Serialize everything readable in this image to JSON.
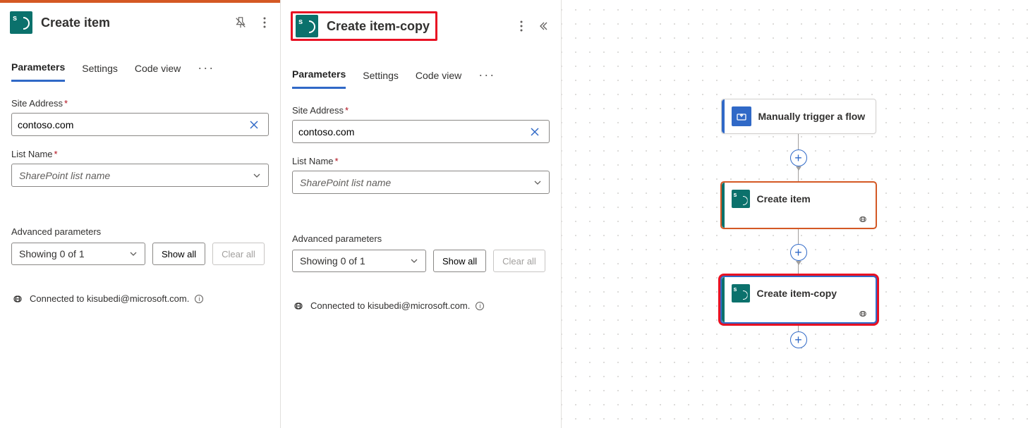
{
  "panel_left": {
    "title": "Create item",
    "tabs": [
      "Parameters",
      "Settings",
      "Code view"
    ],
    "active_tab": "Parameters",
    "site_label": "Site Address",
    "site_value": "contoso.com",
    "list_label": "List Name",
    "list_placeholder": "SharePoint list name",
    "adv_label": "Advanced parameters",
    "adv_selector": "Showing 0 of 1",
    "show_all": "Show all",
    "clear_all": "Clear all",
    "connected": "Connected to kisubedi@microsoft.com."
  },
  "panel_right": {
    "title": "Create item-copy",
    "tabs": [
      "Parameters",
      "Settings",
      "Code view"
    ],
    "active_tab": "Parameters",
    "site_label": "Site Address",
    "site_value": "contoso.com",
    "list_label": "List Name",
    "list_placeholder": "SharePoint list name",
    "adv_label": "Advanced parameters",
    "adv_selector": "Showing 0 of 1",
    "show_all": "Show all",
    "clear_all": "Clear all",
    "connected": "Connected to kisubedi@microsoft.com."
  },
  "canvas": {
    "trigger": "Manually trigger a flow",
    "node1": "Create item",
    "node2": "Create item-copy"
  }
}
